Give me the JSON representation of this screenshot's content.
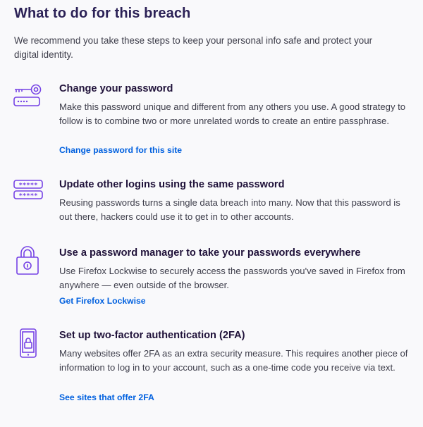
{
  "page": {
    "title": "What to do for this breach",
    "intro": "We recommend you take these steps to keep your personal info safe and protect your digital identity."
  },
  "colors": {
    "title": "#2b2156",
    "icon_purple": "#7542e5",
    "link_blue": "#0060df",
    "body_text": "#3d3d4a"
  },
  "steps": [
    {
      "icon": "key-password-icon",
      "title": "Change your password",
      "description": "Make this password unique and different from any others you use. A good strategy to follow is to combine two or more unrelated words to create an entire passphrase.",
      "link": "Change password for this site"
    },
    {
      "icon": "password-fields-icon",
      "title": "Update other logins using the same password",
      "description": "Reusing passwords turns a single data breach into many. Now that this password is out there, hackers could use it to get in to other accounts.",
      "link": ""
    },
    {
      "icon": "padlock-icon",
      "title": "Use a password manager to take your passwords everywhere",
      "description": "Use Firefox Lockwise to securely access the passwords you've saved in Firefox from anywhere — even outside of the browser.",
      "link": "Get Firefox Lockwise"
    },
    {
      "icon": "phone-lock-icon",
      "title": "Set up two-factor authentication (2FA)",
      "description": "Many websites offer 2FA as an extra security measure. This requires another piece of information to log in to your account, such as a one-time code you receive via text.",
      "link": "See sites that offer 2FA"
    }
  ]
}
